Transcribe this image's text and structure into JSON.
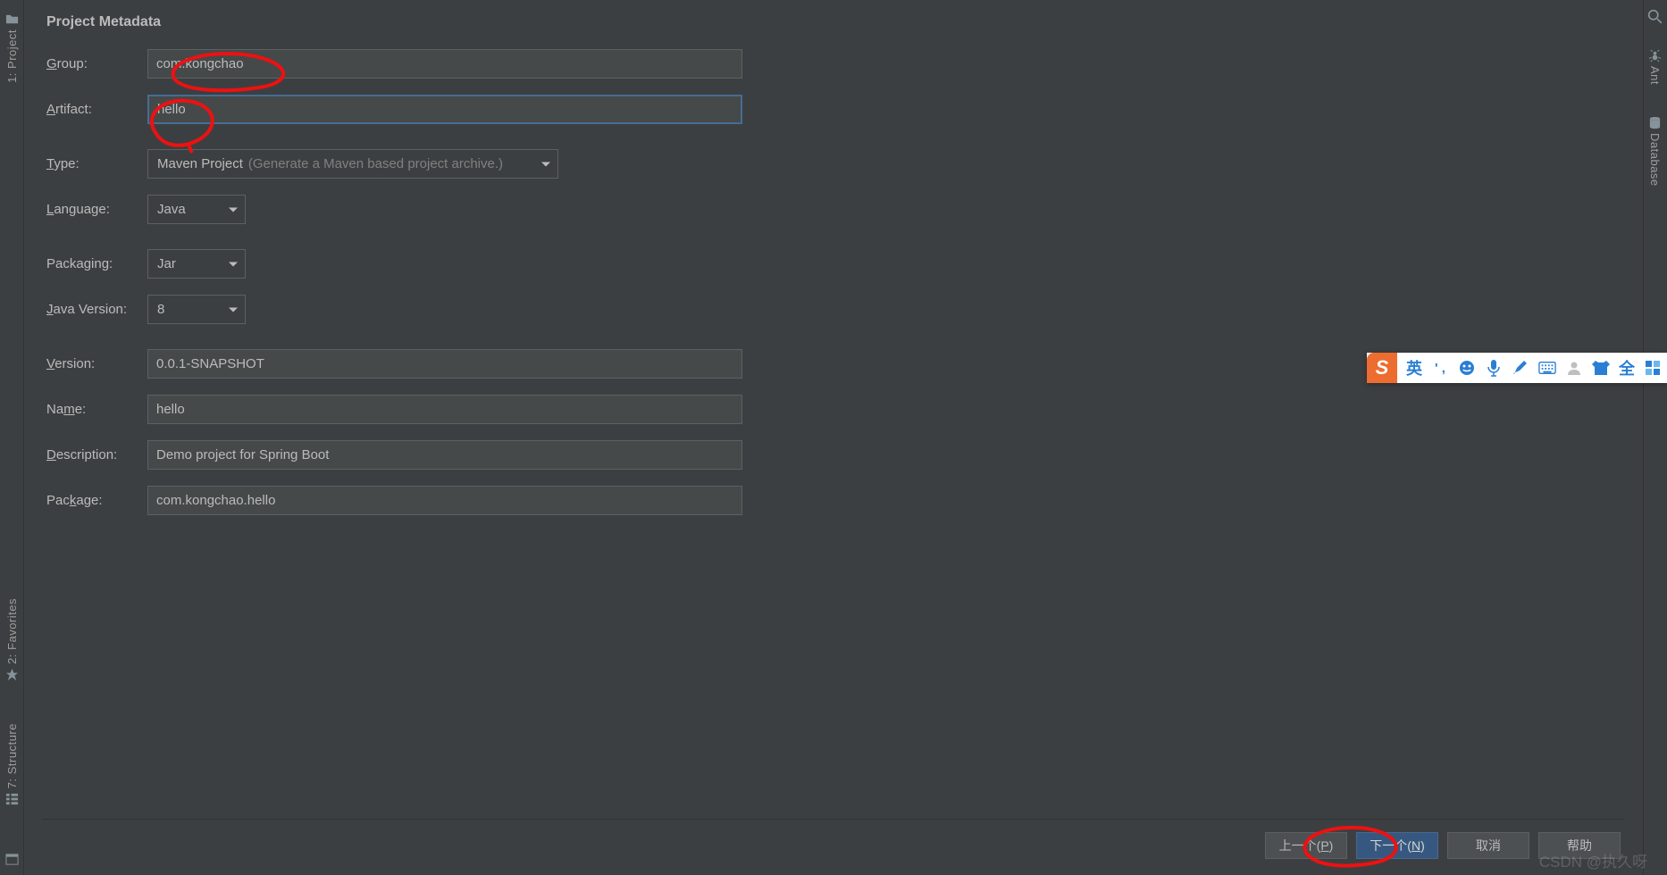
{
  "heading": "Project Metadata",
  "labels": {
    "group": "roup:",
    "artifact": "rtifact:",
    "type": "ype:",
    "language": "anguage:",
    "packaging": "Packaging:",
    "javaVersion": "ava Version:",
    "version": "ersion:",
    "name": "Na",
    "name_end": "e:",
    "description": "escription:",
    "package": "Pac",
    "package_end": "age:"
  },
  "underlineLetters": {
    "group": "G",
    "artifact": "A",
    "type": "T",
    "language": "L",
    "java": "J",
    "version": "V",
    "name_mid": "m",
    "description": "D",
    "package_mid": "k"
  },
  "fields": {
    "group": "com.kongchao",
    "artifact": "hello",
    "type_value": "Maven Project",
    "type_hint": "(Generate a Maven based project archive.)",
    "language": "Java",
    "packaging": "Jar",
    "javaVersion": "8",
    "version": "0.0.1-SNAPSHOT",
    "name": "hello",
    "description": "Demo project for Spring Boot",
    "package": "com.kongchao.hello"
  },
  "buttons": {
    "prev": "上一个(",
    "prev_u": "P",
    "prev_end": ")",
    "next": "下一个(",
    "next_u": "N",
    "next_end": ")",
    "cancel": "取消",
    "help": "帮助"
  },
  "leftTools": {
    "project": "1: Project",
    "favorites": "2: Favorites",
    "structure": "7: Structure"
  },
  "rightTools": {
    "ant": "Ant",
    "database": "Database"
  },
  "ime": {
    "logo": "S",
    "lang": "英",
    "full": "全"
  },
  "watermark": "CSDN @执久呀"
}
